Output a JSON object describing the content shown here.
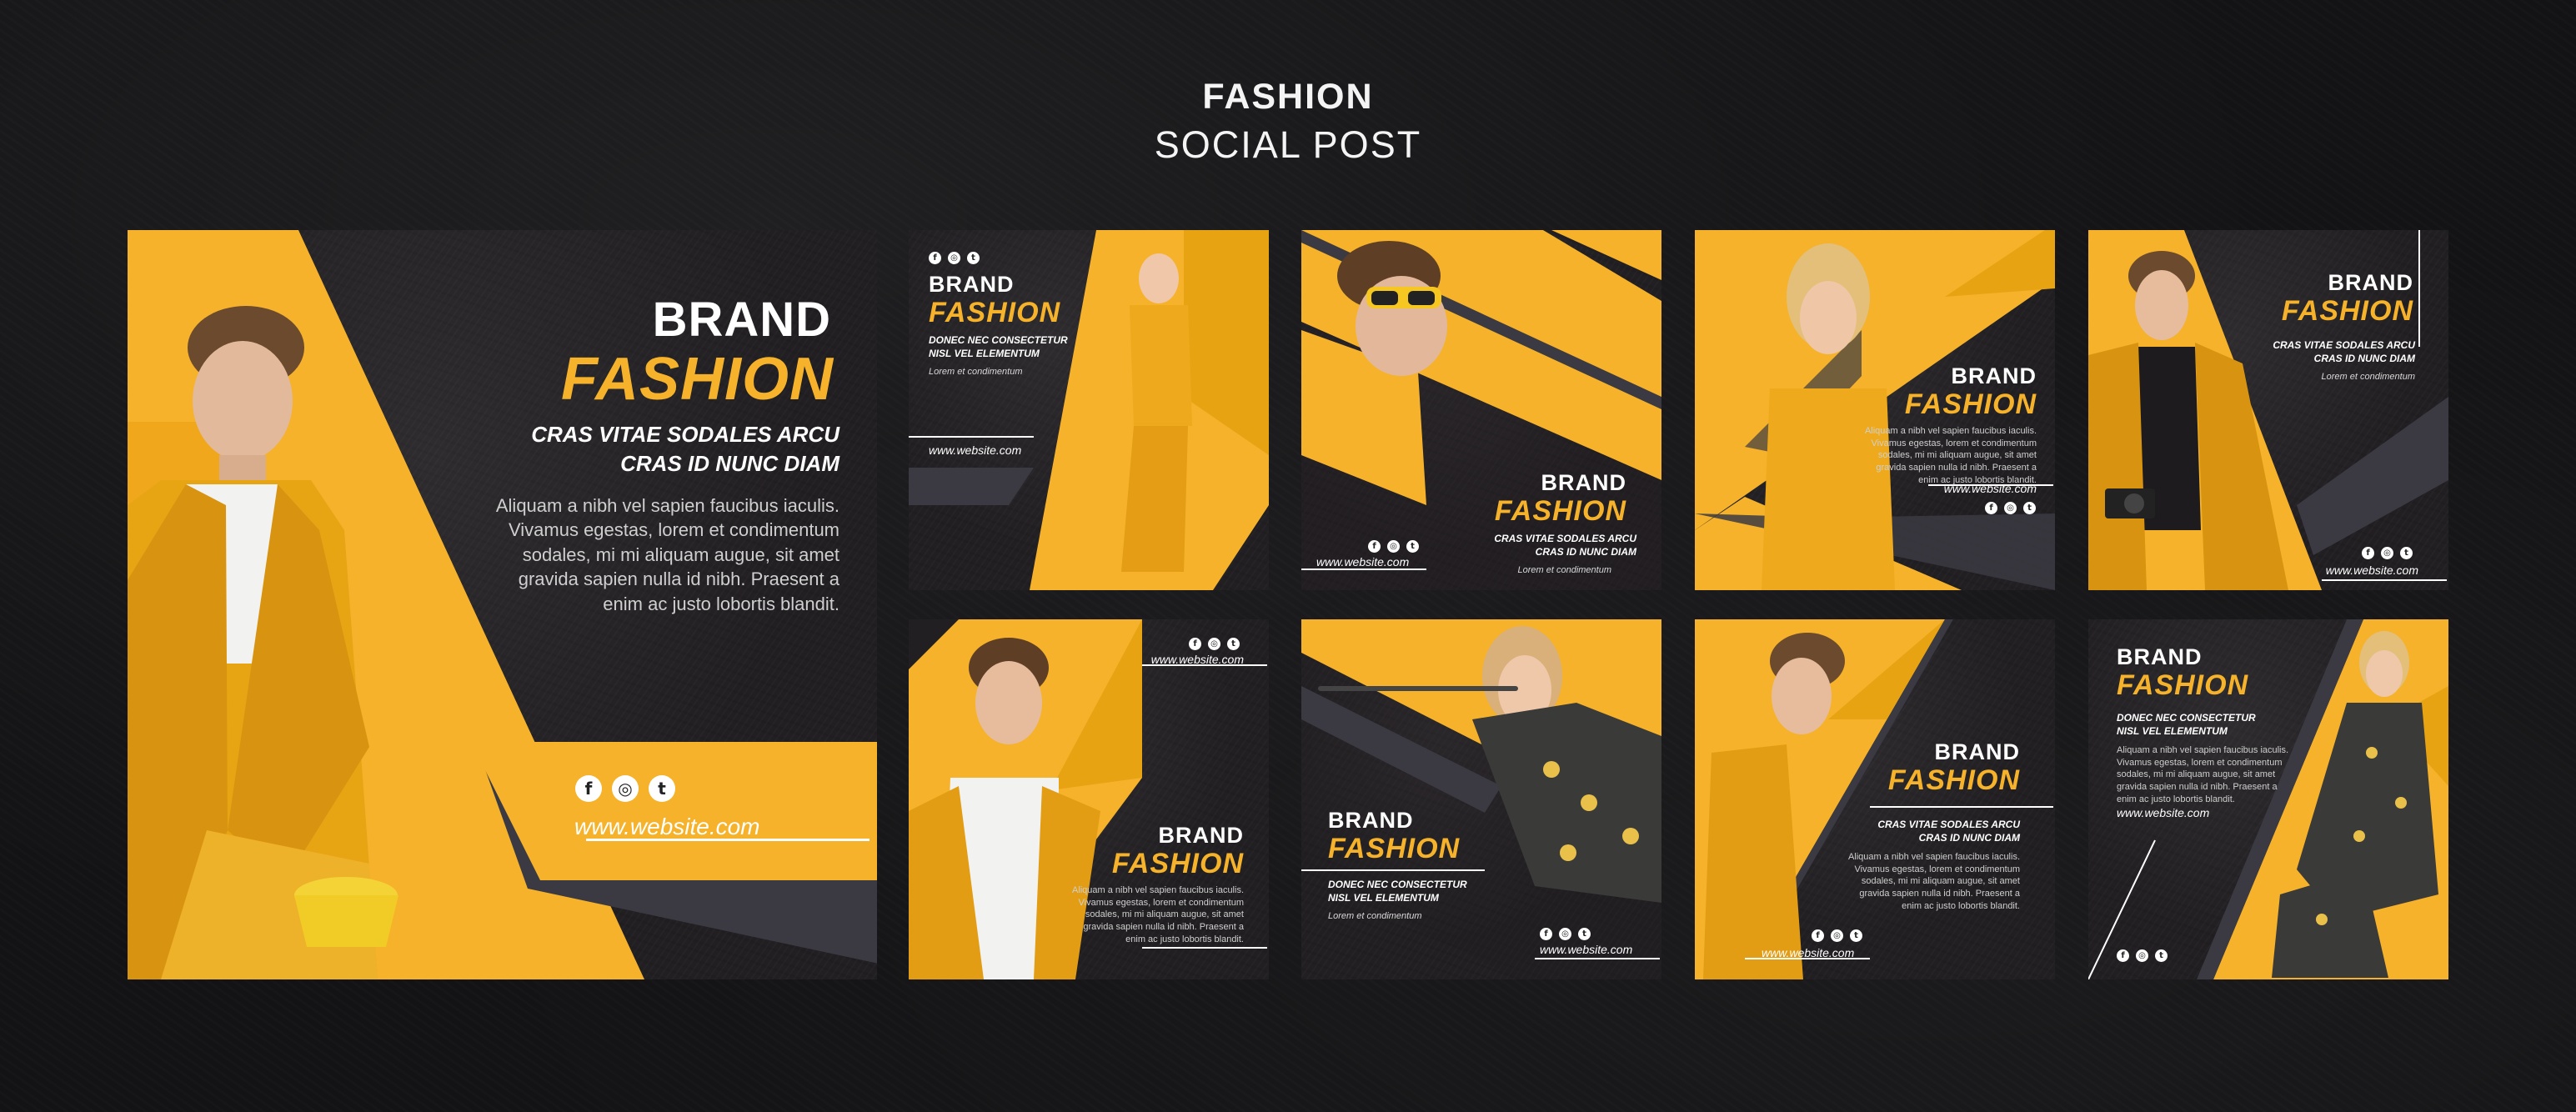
{
  "header": {
    "title": "FASHION",
    "subtitle": "SOCIAL POST"
  },
  "colors": {
    "accent": "#f5b22a",
    "dark": "#221f22",
    "slate": "#3b3a42"
  },
  "icons": [
    "facebook-icon",
    "instagram-icon",
    "twitter-icon"
  ],
  "icon_glyphs": {
    "facebook": "f",
    "instagram": "◎",
    "twitter": "t"
  },
  "posts": {
    "main": {
      "brand": "BRAND",
      "fashion": "FASHION",
      "sub": "CRAS VITAE SODALES ARCU\nCRAS ID NUNC DIAM",
      "body": "Aliquam a nibh vel sapien faucibus iaculis.\nVivamus egestas, lorem et condimentum\nsodales, mi mi aliquam augue, sit amet\ngravida sapien nulla id nibh. Praesent a\nenim ac justo lobortis blandit.",
      "website": "www.website.com"
    },
    "p1": {
      "brand": "BRAND",
      "fashion": "FASHION",
      "sub": "DONEC NEC CONSECTETUR\nNISL VEL ELEMENTUM",
      "lorem": "Lorem et condimentum",
      "website": "www.website.com"
    },
    "p2": {
      "brand": "BRAND",
      "fashion": "FASHION",
      "sub": "CRAS VITAE SODALES ARCU\nCRAS ID NUNC DIAM",
      "lorem": "Lorem et condimentum",
      "website": "www.website.com"
    },
    "p3": {
      "brand": "BRAND",
      "fashion": "FASHION",
      "body": "Aliquam a nibh vel sapien faucibus iaculis.\nVivamus egestas, lorem et condimentum\nsodales, mi mi aliquam augue, sit amet\ngravida sapien nulla id nibh. Praesent a\nenim ac justo lobortis blandit.",
      "website": "www.website.com"
    },
    "p4": {
      "brand": "BRAND",
      "fashion": "FASHION",
      "sub": "CRAS VITAE SODALES ARCU\nCRAS ID NUNC DIAM",
      "lorem": "Lorem et condimentum",
      "website": "www.website.com"
    },
    "p5": {
      "brand": "BRAND",
      "fashion": "FASHION",
      "body": "Aliquam a nibh vel sapien faucibus iaculis.\nVivamus egestas, lorem et condimentum\nsodales, mi mi aliquam augue, sit amet\ngravida sapien nulla id nibh. Praesent a\nenim ac justo lobortis blandit.",
      "website": "www.website.com"
    },
    "p6": {
      "brand": "BRAND",
      "fashion": "FASHION",
      "sub": "DONEC NEC CONSECTETUR\nNISL VEL ELEMENTUM",
      "lorem": "Lorem et condimentum",
      "website": "www.website.com"
    },
    "p7": {
      "brand": "BRAND",
      "fashion": "FASHION",
      "sub": "CRAS VITAE SODALES ARCU\nCRAS ID NUNC DIAM",
      "body": "Aliquam a nibh vel sapien faucibus iaculis.\nVivamus egestas, lorem et condimentum\nsodales, mi mi aliquam augue, sit amet\ngravida sapien nulla id nibh. Praesent a\nenim ac justo lobortis blandit.",
      "website": "www.website.com"
    },
    "p8": {
      "brand": "BRAND",
      "fashion": "FASHION",
      "sub": "DONEC NEC CONSECTETUR\nNISL VEL ELEMENTUM",
      "body": "Aliquam a nibh vel sapien faucibus iaculis.\nVivamus egestas, lorem et condimentum\nsodales, mi mi aliquam augue, sit amet\ngravida sapien nulla id nibh. Praesent a\nenim ac justo lobortis blandit.",
      "website": "www.website.com"
    }
  }
}
